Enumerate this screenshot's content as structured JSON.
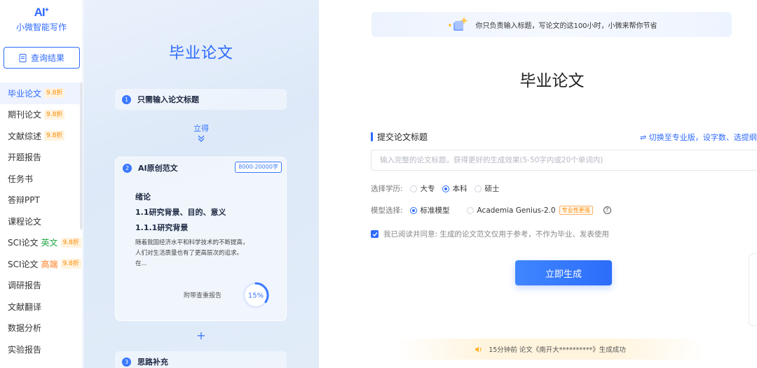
{
  "brand": {
    "mark": "AI",
    "name": "小微智能写作"
  },
  "sidebar": {
    "query_label": "查询结果",
    "items": [
      {
        "label": "毕业论文",
        "badge": "9.8折",
        "active": true
      },
      {
        "label": "期刊论文",
        "badge": "9.8折"
      },
      {
        "label": "文献综述",
        "badge": "9.8折"
      },
      {
        "label": "开题报告"
      },
      {
        "label": "任务书"
      },
      {
        "label": "答辩PPT"
      },
      {
        "label": "课程论文"
      },
      {
        "label": "SCI论文",
        "keyword": "英文",
        "keyword_color": "#22a845",
        "badge": "9.8折"
      },
      {
        "label": "SCI论文",
        "keyword": "高端",
        "keyword_color": "#ff7a1a",
        "badge": "9.8折"
      },
      {
        "label": "调研报告"
      },
      {
        "label": "文献翻译"
      },
      {
        "label": "数据分析"
      },
      {
        "label": "实验报告"
      }
    ]
  },
  "promo": {
    "title": "毕业论文",
    "step1": {
      "num": "1",
      "label": "只需输入论文标题"
    },
    "arrow_text": "立得",
    "step2": {
      "num": "2",
      "label": "AI原创范文",
      "range": "8000-20000字"
    },
    "sample": {
      "h1": "绪论",
      "h2": "1.1研究背景、目的、意义",
      "h3": "1.1.1研究背景",
      "body_lines": [
        "随着我国经济水平和科学技术的不断提高，",
        "人们对生活质量也有了更高层次的追求。",
        "在..."
      ]
    },
    "report_label": "附带查重报告",
    "similarity_percent": 15,
    "similarity_text": "15%",
    "plus": "+",
    "step3": {
      "num": "3",
      "label": "思路补充"
    }
  },
  "main": {
    "banner_text": "你只负责输入标题，写论文的这100小时，小微来帮你节省",
    "title": "毕业论文",
    "section_label": "提交论文标题",
    "switch_link": "⇌ 切换至专业版，设字数、选提纲",
    "input_placeholder": "输入完整的论文标题，获得更好的生成效果(5-50字内或20个单词内)",
    "input_value": "",
    "degree_label": "选择学历:",
    "degree_options": [
      {
        "label": "大专",
        "selected": false
      },
      {
        "label": "本科",
        "selected": true
      },
      {
        "label": "硕士",
        "selected": false
      }
    ],
    "model_label": "模型选择:",
    "model_options": [
      {
        "label": "标准模型",
        "selected": true
      },
      {
        "label": "Academia Genius-2.0",
        "selected": false,
        "tag": "专业性更强"
      }
    ],
    "help_glyph": "?",
    "agree_checked": true,
    "agree_text": "我已阅读并同意: 生成的论文范文仅用于参考，不作为毕业、发表使用",
    "generate_label": "立即生成",
    "notice_text": "15分钟前 论文《南开大**********》生成成功"
  },
  "colors": {
    "accent": "#2f6bff",
    "badge_bg": "#fff3df",
    "badge_text": "#ff8a00"
  }
}
